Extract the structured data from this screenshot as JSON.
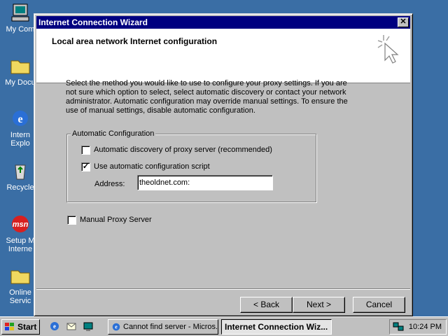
{
  "desktop": {
    "icons": [
      {
        "label": "My Com",
        "icon": "computer-icon"
      },
      {
        "label": "My Docu",
        "icon": "folder-icon"
      },
      {
        "label": "Intern",
        "label2": "Explo",
        "icon": "ie-icon"
      },
      {
        "label": "Recycle",
        "icon": "recycle-bin-icon"
      },
      {
        "label": "Setup M",
        "label2": "Interne",
        "icon": "msn-icon"
      },
      {
        "label": "Online",
        "label2": "Servic",
        "icon": "folder-icon"
      }
    ]
  },
  "window": {
    "title": "Internet Connection Wizard",
    "close_label": "✕",
    "header_title": "Local area network Internet configuration",
    "intro_text": "Select the method you would like to use to configure your proxy settings.  If you are not sure which option to select, select automatic discovery or contact your network administrator.  Automatic configuration may override manual settings.  To ensure the use of manual settings, disable automatic configuration.",
    "group_label": "Automatic Configuration",
    "options": {
      "auto_discovery": {
        "label": "Automatic discovery of proxy server (recommended)",
        "checked": false
      },
      "auto_script": {
        "label": "Use automatic configuration script",
        "checked": true
      },
      "manual_proxy": {
        "label": "Manual Proxy Server",
        "checked": false
      }
    },
    "address_label": "Address:",
    "address_value": "theoldnet.com:",
    "buttons": {
      "back": "< Back",
      "next": "Next >",
      "cancel": "Cancel"
    }
  },
  "taskbar": {
    "start_label": "Start",
    "tasks": [
      {
        "label": "Cannot find server - Micros...",
        "active": false
      },
      {
        "label": "Internet Connection Wiz...",
        "active": true
      }
    ],
    "clock": "10:24 PM"
  },
  "colors": {
    "desktop": "#3a6ea5",
    "titlebar": "#000080",
    "face": "#c0c0c0"
  }
}
